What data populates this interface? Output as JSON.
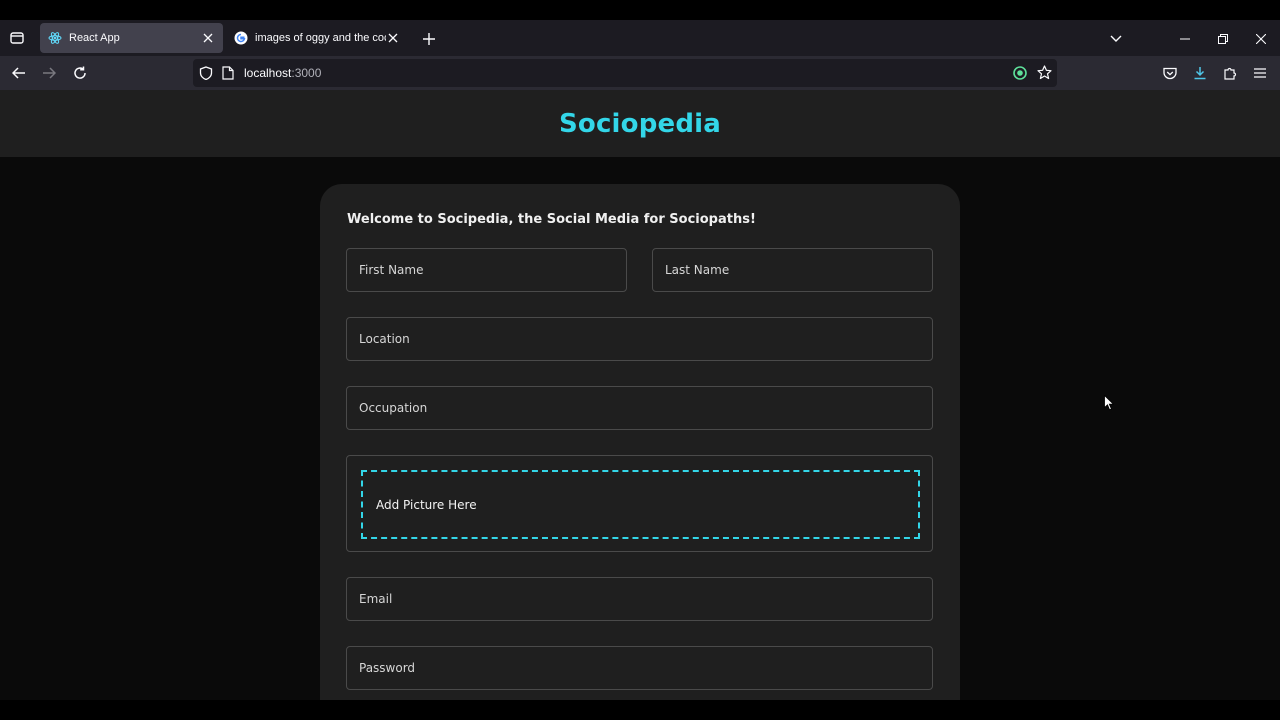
{
  "browser": {
    "tabs": [
      {
        "title": "React App",
        "icon": "react-icon",
        "active": true
      },
      {
        "title": "images of oggy and the cockroaches",
        "icon": "google-icon",
        "active": false
      }
    ],
    "url_host": "localhost",
    "url_port": ":3000"
  },
  "app": {
    "brand": "Sociopedia",
    "welcome": "Welcome to Socipedia, the Social Media for Sociopaths!",
    "form": {
      "first_name": "First Name",
      "last_name": "Last Name",
      "location": "Location",
      "occupation": "Occupation",
      "picture": "Add Picture Here",
      "email": "Email",
      "password": "Password"
    }
  },
  "colors": {
    "accent": "#33d6e8",
    "page_bg": "#0a0a0a",
    "card_bg": "#1f1f1f"
  }
}
